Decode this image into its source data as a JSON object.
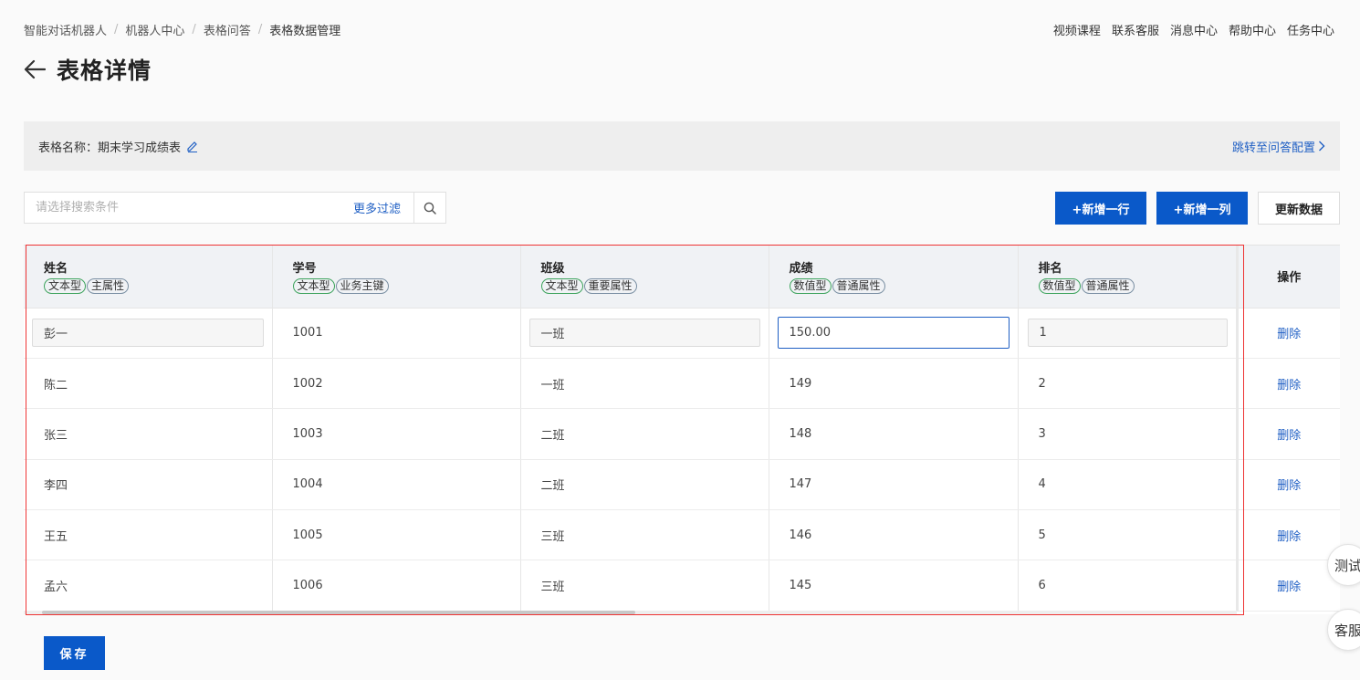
{
  "breadcrumb": [
    "智能对话机器人",
    "机器人中心",
    "表格问答",
    "表格数据管理"
  ],
  "top_links": [
    "视频课程",
    "联系客服",
    "消息中心",
    "帮助中心",
    "任务中心"
  ],
  "page_title": "表格详情",
  "info_bar": {
    "label": "表格名称：",
    "table_name": "期末学习成绩表",
    "jump_link": "跳转至问答配置"
  },
  "search": {
    "placeholder": "请选择搜索条件",
    "more_filter": "更多过滤"
  },
  "buttons": {
    "add_row": "+新增一行",
    "add_col": "+新增一列",
    "refresh": "更新数据",
    "save": "保存"
  },
  "columns": [
    {
      "name": "姓名",
      "tags": [
        "文本型",
        "主属性"
      ]
    },
    {
      "name": "学号",
      "tags": [
        "文本型",
        "业务主键"
      ]
    },
    {
      "name": "班级",
      "tags": [
        "文本型",
        "重要属性"
      ]
    },
    {
      "name": "成绩",
      "tags": [
        "数值型",
        "普通属性"
      ]
    },
    {
      "name": "排名",
      "tags": [
        "数值型",
        "普通属性"
      ]
    }
  ],
  "op_header": "操作",
  "delete_label": "删除",
  "edit_row": [
    "彭一",
    "1001",
    "一班",
    "150.00",
    "1"
  ],
  "rows": [
    [
      "陈二",
      "1002",
      "一班",
      "149",
      "2"
    ],
    [
      "张三",
      "1003",
      "二班",
      "148",
      "3"
    ],
    [
      "李四",
      "1004",
      "二班",
      "147",
      "4"
    ],
    [
      "王五",
      "1005",
      "三班",
      "146",
      "5"
    ],
    [
      "孟六",
      "1006",
      "三班",
      "145",
      "6"
    ]
  ],
  "float_buttons": [
    "测试",
    "客服"
  ],
  "colors": {
    "primary": "#0a59c9",
    "link": "#1f5fc4",
    "tag_green": "#3da35d",
    "highlight_frame": "#e33333"
  }
}
